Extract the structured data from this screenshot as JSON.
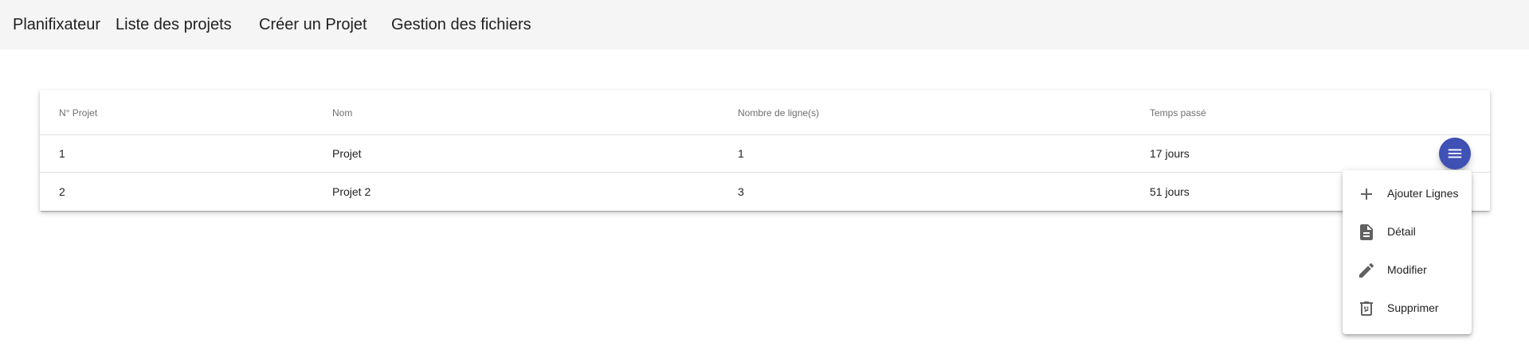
{
  "toolbar": {
    "brand": "Planifixateur",
    "nav": [
      "Liste des projets",
      "Créer un Projet",
      "Gestion des fichiers"
    ]
  },
  "table": {
    "columns": [
      "N° Projet",
      "Nom",
      "Nombre de ligne(s)",
      "Temps passé"
    ],
    "rows": [
      [
        "1",
        "Projet",
        "1",
        "17 jours"
      ],
      [
        "2",
        "Projet 2",
        "3",
        "51 jours"
      ]
    ]
  },
  "fab": {
    "icon": "menu-icon",
    "color": "#3f51b5"
  },
  "menu": {
    "items": [
      {
        "icon": "plus-icon",
        "label": "Ajouter Lignes"
      },
      {
        "icon": "document-icon",
        "label": "Détail"
      },
      {
        "icon": "pencil-icon",
        "label": "Modifier"
      },
      {
        "icon": "trash-icon",
        "label": "Supprimer"
      }
    ]
  },
  "colors": {
    "toolbar_bg": "#f5f5f5",
    "accent": "#3f51b5",
    "icon_gray": "#616161"
  }
}
